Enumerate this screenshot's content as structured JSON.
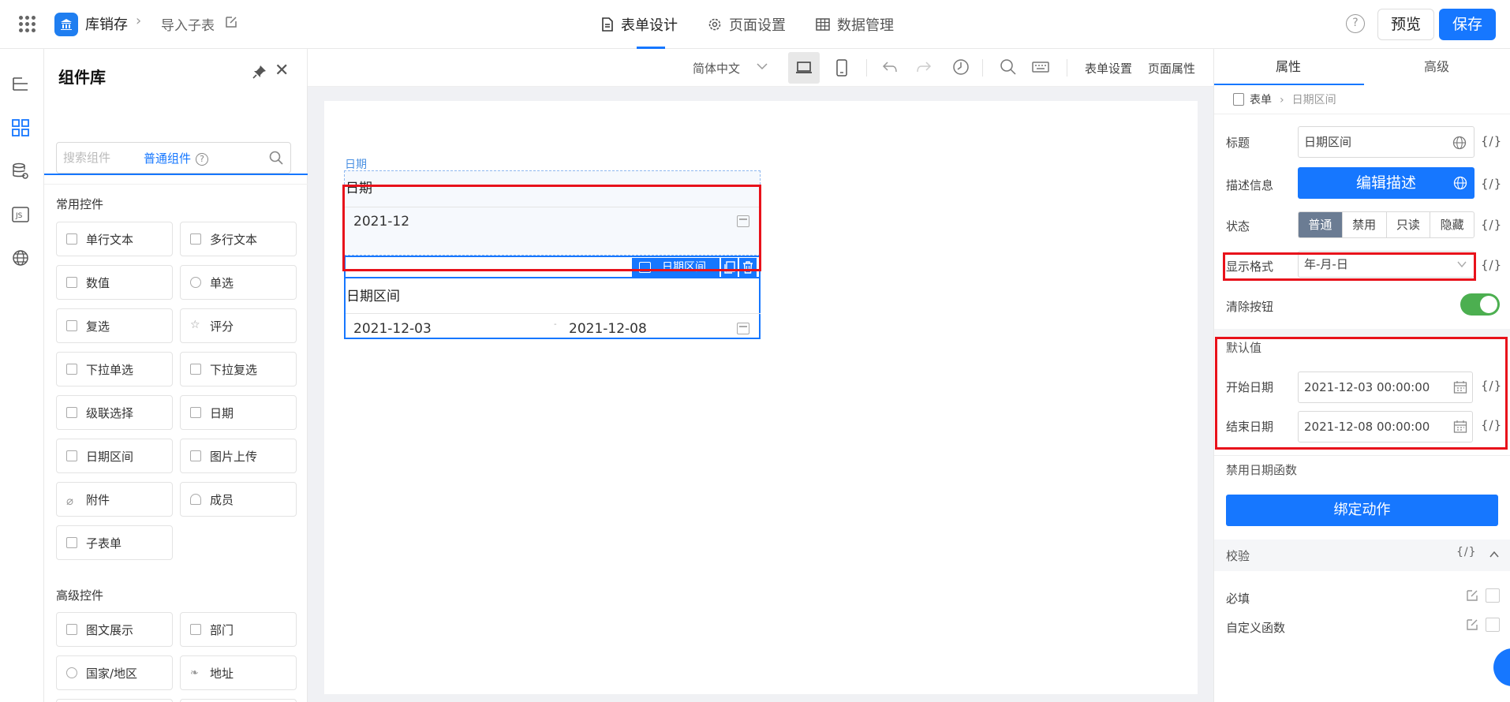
{
  "topbar": {
    "app_name": "库销存",
    "page_name": "导入子表",
    "tabs": [
      {
        "label": "表单设计",
        "icon": "form-doc-icon",
        "active": true
      },
      {
        "label": "页面设置",
        "icon": "gear-icon",
        "active": false
      },
      {
        "label": "数据管理",
        "icon": "table-icon",
        "active": false
      }
    ],
    "help_symbol": "?",
    "preview_label": "预览",
    "save_label": "保存"
  },
  "rail": {
    "items": [
      "outline-icon",
      "components-icon",
      "database-settings-icon",
      "js-icon",
      "globe-icon"
    ],
    "js_text": "JS"
  },
  "library": {
    "title": "组件库",
    "tab_label": "普通组件",
    "search_placeholder": "搜索组件",
    "groups": [
      {
        "title": "常用控件",
        "items": [
          "单行文本",
          "多行文本",
          "数值",
          "单选",
          "复选",
          "评分",
          "下拉单选",
          "下拉复选",
          "级联选择",
          "日期",
          "日期区间",
          "图片上传",
          "附件",
          "成员",
          "子表单"
        ]
      },
      {
        "title": "高级控件",
        "items": [
          "图文展示",
          "部门",
          "国家/地区",
          "地址"
        ]
      }
    ]
  },
  "toolbar": {
    "language": "简体中文",
    "form_settings": "表单设置",
    "page_props": "页面属性"
  },
  "canvas": {
    "date_field": {
      "tag": "日期",
      "label": "日期",
      "value": "2021-12"
    },
    "range_field": {
      "chip_label": "日期区间",
      "label": "日期区间",
      "start": "2021-12-03",
      "separator": "-",
      "end": "2021-12-08"
    }
  },
  "panel": {
    "tabs": [
      "属性",
      "高级"
    ],
    "crumb_root": "表单",
    "crumb_current": "日期区间",
    "fx": "{/}",
    "title_label": "标题",
    "title_value": "日期区间",
    "desc_label": "描述信息",
    "desc_button": "编辑描述",
    "status_label": "状态",
    "status_options": [
      "普通",
      "禁用",
      "只读",
      "隐藏"
    ],
    "format_label": "显示格式",
    "format_value": "年-月-日",
    "clear_label": "清除按钮",
    "clear_on": true,
    "default_section": "默认值",
    "start_label": "开始日期",
    "start_value": "2021-12-03 00:00:00",
    "end_label": "结束日期",
    "end_value": "2021-12-08 00:00:00",
    "disable_fn_section": "禁用日期函数",
    "bind_button": "绑定动作",
    "verify_section": "校验",
    "required_label": "必填",
    "custom_fn_label": "自定义函数"
  },
  "colors": {
    "primary": "#1677ff",
    "highlight_red": "#e8121b",
    "toggle_green": "#4caf50"
  }
}
